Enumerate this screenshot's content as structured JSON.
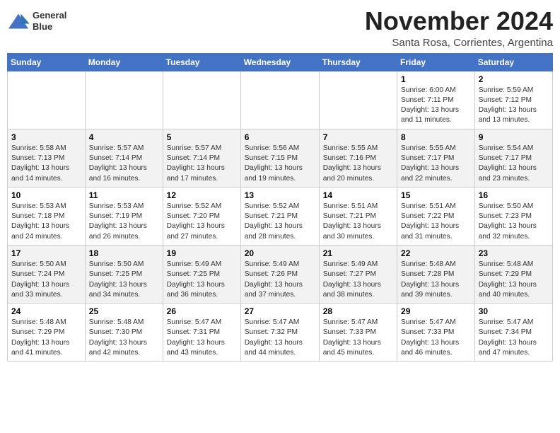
{
  "header": {
    "logo_line1": "General",
    "logo_line2": "Blue",
    "month_title": "November 2024",
    "subtitle": "Santa Rosa, Corrientes, Argentina"
  },
  "weekdays": [
    "Sunday",
    "Monday",
    "Tuesday",
    "Wednesday",
    "Thursday",
    "Friday",
    "Saturday"
  ],
  "weeks": [
    [
      {
        "day": "",
        "info": ""
      },
      {
        "day": "",
        "info": ""
      },
      {
        "day": "",
        "info": ""
      },
      {
        "day": "",
        "info": ""
      },
      {
        "day": "",
        "info": ""
      },
      {
        "day": "1",
        "info": "Sunrise: 6:00 AM\nSunset: 7:11 PM\nDaylight: 13 hours and 11 minutes."
      },
      {
        "day": "2",
        "info": "Sunrise: 5:59 AM\nSunset: 7:12 PM\nDaylight: 13 hours and 13 minutes."
      }
    ],
    [
      {
        "day": "3",
        "info": "Sunrise: 5:58 AM\nSunset: 7:13 PM\nDaylight: 13 hours and 14 minutes."
      },
      {
        "day": "4",
        "info": "Sunrise: 5:57 AM\nSunset: 7:14 PM\nDaylight: 13 hours and 16 minutes."
      },
      {
        "day": "5",
        "info": "Sunrise: 5:57 AM\nSunset: 7:14 PM\nDaylight: 13 hours and 17 minutes."
      },
      {
        "day": "6",
        "info": "Sunrise: 5:56 AM\nSunset: 7:15 PM\nDaylight: 13 hours and 19 minutes."
      },
      {
        "day": "7",
        "info": "Sunrise: 5:55 AM\nSunset: 7:16 PM\nDaylight: 13 hours and 20 minutes."
      },
      {
        "day": "8",
        "info": "Sunrise: 5:55 AM\nSunset: 7:17 PM\nDaylight: 13 hours and 22 minutes."
      },
      {
        "day": "9",
        "info": "Sunrise: 5:54 AM\nSunset: 7:17 PM\nDaylight: 13 hours and 23 minutes."
      }
    ],
    [
      {
        "day": "10",
        "info": "Sunrise: 5:53 AM\nSunset: 7:18 PM\nDaylight: 13 hours and 24 minutes."
      },
      {
        "day": "11",
        "info": "Sunrise: 5:53 AM\nSunset: 7:19 PM\nDaylight: 13 hours and 26 minutes."
      },
      {
        "day": "12",
        "info": "Sunrise: 5:52 AM\nSunset: 7:20 PM\nDaylight: 13 hours and 27 minutes."
      },
      {
        "day": "13",
        "info": "Sunrise: 5:52 AM\nSunset: 7:21 PM\nDaylight: 13 hours and 28 minutes."
      },
      {
        "day": "14",
        "info": "Sunrise: 5:51 AM\nSunset: 7:21 PM\nDaylight: 13 hours and 30 minutes."
      },
      {
        "day": "15",
        "info": "Sunrise: 5:51 AM\nSunset: 7:22 PM\nDaylight: 13 hours and 31 minutes."
      },
      {
        "day": "16",
        "info": "Sunrise: 5:50 AM\nSunset: 7:23 PM\nDaylight: 13 hours and 32 minutes."
      }
    ],
    [
      {
        "day": "17",
        "info": "Sunrise: 5:50 AM\nSunset: 7:24 PM\nDaylight: 13 hours and 33 minutes."
      },
      {
        "day": "18",
        "info": "Sunrise: 5:50 AM\nSunset: 7:25 PM\nDaylight: 13 hours and 34 minutes."
      },
      {
        "day": "19",
        "info": "Sunrise: 5:49 AM\nSunset: 7:25 PM\nDaylight: 13 hours and 36 minutes."
      },
      {
        "day": "20",
        "info": "Sunrise: 5:49 AM\nSunset: 7:26 PM\nDaylight: 13 hours and 37 minutes."
      },
      {
        "day": "21",
        "info": "Sunrise: 5:49 AM\nSunset: 7:27 PM\nDaylight: 13 hours and 38 minutes."
      },
      {
        "day": "22",
        "info": "Sunrise: 5:48 AM\nSunset: 7:28 PM\nDaylight: 13 hours and 39 minutes."
      },
      {
        "day": "23",
        "info": "Sunrise: 5:48 AM\nSunset: 7:29 PM\nDaylight: 13 hours and 40 minutes."
      }
    ],
    [
      {
        "day": "24",
        "info": "Sunrise: 5:48 AM\nSunset: 7:29 PM\nDaylight: 13 hours and 41 minutes."
      },
      {
        "day": "25",
        "info": "Sunrise: 5:48 AM\nSunset: 7:30 PM\nDaylight: 13 hours and 42 minutes."
      },
      {
        "day": "26",
        "info": "Sunrise: 5:47 AM\nSunset: 7:31 PM\nDaylight: 13 hours and 43 minutes."
      },
      {
        "day": "27",
        "info": "Sunrise: 5:47 AM\nSunset: 7:32 PM\nDaylight: 13 hours and 44 minutes."
      },
      {
        "day": "28",
        "info": "Sunrise: 5:47 AM\nSunset: 7:33 PM\nDaylight: 13 hours and 45 minutes."
      },
      {
        "day": "29",
        "info": "Sunrise: 5:47 AM\nSunset: 7:33 PM\nDaylight: 13 hours and 46 minutes."
      },
      {
        "day": "30",
        "info": "Sunrise: 5:47 AM\nSunset: 7:34 PM\nDaylight: 13 hours and 47 minutes."
      }
    ]
  ]
}
